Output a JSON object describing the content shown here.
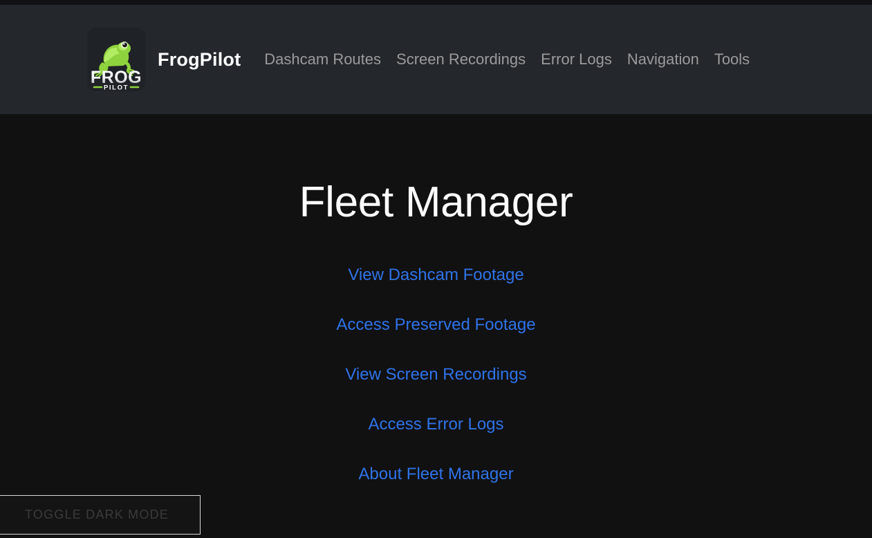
{
  "header": {
    "brand_name": "FrogPilot",
    "logo": {
      "icon_name": "frogpilot-logo-icon",
      "word_top": "FROG",
      "word_bottom": "PILOT",
      "frog_color": "#8ed33d",
      "frog_color_dark": "#5f9e24",
      "badge_color": "#1f2226"
    },
    "nav_links": [
      {
        "label": "Dashcam Routes"
      },
      {
        "label": "Screen Recordings"
      },
      {
        "label": "Error Logs"
      },
      {
        "label": "Navigation"
      },
      {
        "label": "Tools"
      }
    ]
  },
  "main": {
    "title": "Fleet Manager",
    "links": [
      {
        "label": "View Dashcam Footage"
      },
      {
        "label": "Access Preserved Footage"
      },
      {
        "label": "View Screen Recordings"
      },
      {
        "label": "Access Error Logs"
      },
      {
        "label": "About Fleet Manager"
      }
    ]
  },
  "controls": {
    "dark_mode_toggle_label": "Toggle Dark Mode"
  },
  "colors": {
    "header_background": "#24272b",
    "page_background": "#111111",
    "link_blue": "#2f73e8",
    "nav_text": "#9b9b9b",
    "title_white": "#fdfdfd",
    "toggle_border": "#d9d9d9",
    "toggle_text": "#3b3b3b"
  }
}
